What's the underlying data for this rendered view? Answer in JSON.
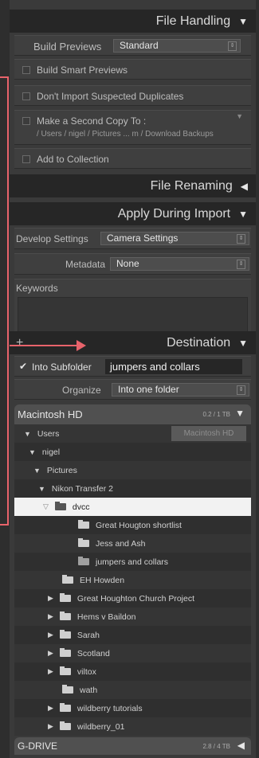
{
  "file_handling": {
    "title": "File Handling",
    "build_previews_label": "Build Previews",
    "build_previews_value": "Standard",
    "build_smart_previews": "Build Smart Previews",
    "dont_import_duplicates": "Don't Import Suspected Duplicates",
    "second_copy_label": "Make a Second Copy To :",
    "second_copy_path": "/ Users / nigel / Pictures ... m / Download Backups",
    "add_to_collection": "Add to Collection"
  },
  "file_renaming": {
    "title": "File Renaming"
  },
  "apply_during_import": {
    "title": "Apply During Import",
    "develop_label": "Develop Settings",
    "develop_value": "Camera Settings",
    "metadata_label": "Metadata",
    "metadata_value": "None",
    "keywords_label": "Keywords"
  },
  "destination": {
    "title": "Destination",
    "plus": "+",
    "into_subfolder_label": "Into Subfolder",
    "into_subfolder_value": "jumpers and collars",
    "organize_label": "Organize",
    "organize_value": "Into one folder",
    "volume_name": "Macintosh HD",
    "volume_size": "0.2 / 1 TB",
    "tooltip": "Macintosh HD",
    "tree": [
      {
        "label": "Users"
      },
      {
        "label": "nigel"
      },
      {
        "label": "Pictures"
      },
      {
        "label": "Nikon Transfer 2"
      },
      {
        "label": "dvcc"
      },
      {
        "label": "Great Hougton shortlist"
      },
      {
        "label": "Jess and Ash"
      },
      {
        "label": "jumpers and collars"
      },
      {
        "label": "EH Howden"
      },
      {
        "label": "Great Houghton Church Project"
      },
      {
        "label": "Hems v Baildon"
      },
      {
        "label": "Sarah"
      },
      {
        "label": "Scotland"
      },
      {
        "label": "viltox"
      },
      {
        "label": "wath"
      },
      {
        "label": "wildberry tutorials"
      },
      {
        "label": "wildberry_01"
      }
    ],
    "drive2_name": "G-DRIVE",
    "drive2_size": "2.8 / 4 TB"
  },
  "colors": {
    "annotation_arrow": "#e8636b",
    "panel_bg": "#3a3a3a",
    "header_bg": "#262626"
  }
}
